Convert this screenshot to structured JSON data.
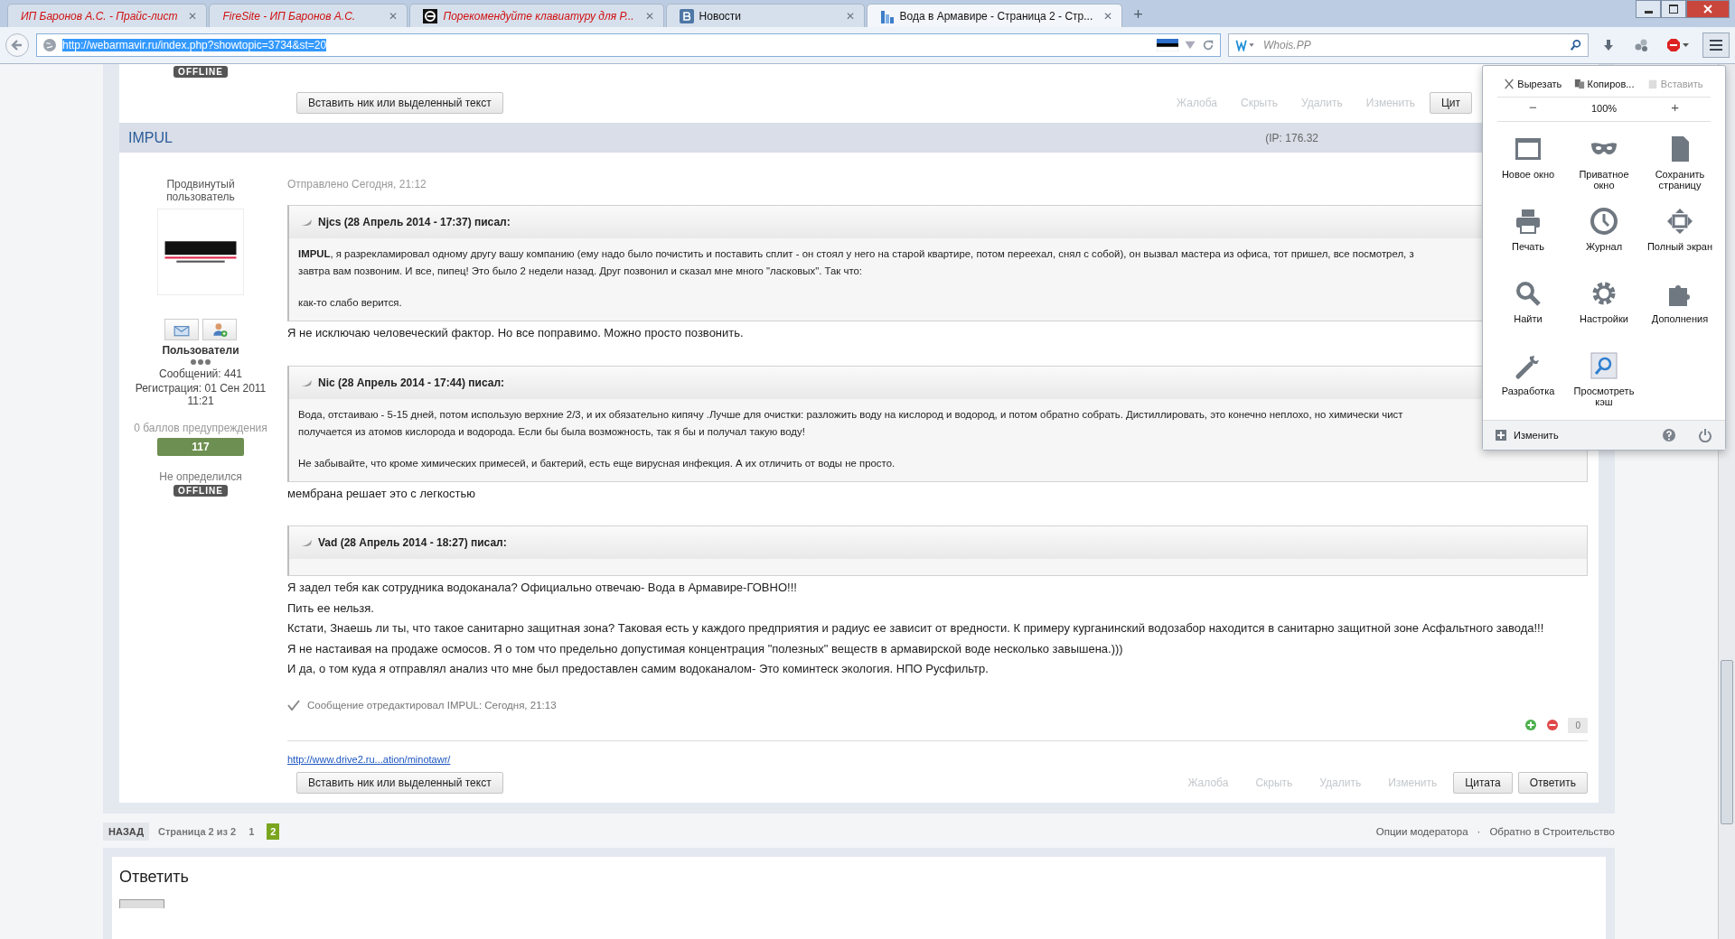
{
  "browser": {
    "tabs": [
      {
        "title": "ИП Баронов А.С. - Прайс-лист",
        "kind": "none",
        "unread": true,
        "selected": false
      },
      {
        "title": "FireSite - ИП Баронов А.С.",
        "kind": "none",
        "unread": true,
        "selected": false
      },
      {
        "title": "Порекомендуйте клавиатуру для Р...",
        "kind": "e-logo",
        "unread": true,
        "selected": false
      },
      {
        "title": "Новости",
        "kind": "vk",
        "unread": false,
        "selected": false
      },
      {
        "title": "Вода в Армавире - Страница 2 - Стр...",
        "kind": "site",
        "unread": false,
        "selected": true
      }
    ],
    "close": "✕",
    "new_tab": "+",
    "url": "http://webarmavir.ru/index.php?showtopic=3734&st=20",
    "search": {
      "placeholder": "Whois.PP"
    }
  },
  "menu": {
    "edit": [
      {
        "label": "Вырезать",
        "kind": "cut",
        "disabled": false
      },
      {
        "label": "Копиров...",
        "kind": "copy",
        "disabled": false
      },
      {
        "label": "Вставить",
        "kind": "paste",
        "disabled": true
      }
    ],
    "zoom": {
      "minus": "−",
      "value": "100%",
      "plus": "+"
    },
    "items": [
      {
        "label": "Новое окно",
        "kind": "window"
      },
      {
        "label": "Приватное окно",
        "kind": "mask"
      },
      {
        "label": "Сохранить страницу",
        "kind": "page"
      },
      {
        "label": "Печать",
        "kind": "printer"
      },
      {
        "label": "Журнал",
        "kind": "clock"
      },
      {
        "label": "Полный экран",
        "kind": "fullscreen"
      },
      {
        "label": "Найти",
        "kind": "search"
      },
      {
        "label": "Настройки",
        "kind": "gear"
      },
      {
        "label": "Дополнения",
        "kind": "puzzle"
      },
      {
        "label": "Разработка",
        "kind": "wrench"
      },
      {
        "label": "Просмотреть кэш",
        "kind": "cache"
      }
    ],
    "customize": "Изменить"
  },
  "previous_post": {
    "status": "OFFLINE",
    "insert_button": "Вставить ник или выделенный текст",
    "actions": [
      {
        "label": "Жалоба",
        "kind": "link"
      },
      {
        "label": "Скрыть",
        "kind": "link"
      },
      {
        "label": "Удалить",
        "kind": "link"
      },
      {
        "label": "Изменить",
        "kind": "link"
      },
      {
        "label": "Цит",
        "kind": "button"
      }
    ]
  },
  "post": {
    "author": "IMPUL",
    "ip": "(IP: 176.32",
    "user": {
      "title": "Продвинутый пользователь",
      "group": "Пользователи",
      "posts": "Сообщений: 441",
      "registered": "Регистрация: 01 Сен 2011 11:21",
      "warnings": "0 баллов предупреждения",
      "reputation": "117",
      "mood": "Не определился",
      "status": "OFFLINE"
    },
    "date": "Отправлено Сегодня, 21:12",
    "body": [
      {
        "kind": "quote",
        "header": "Njcs (28 Апрель 2014 - 17:37) писал:",
        "paragraphs": [
          "**IMPUL**, я разрекламировал одному другу вашу компанию (ему надо было почистить и поставить сплит - он стоял у него на старой квартире, потом переехал, снял с собой), он вызвал мастера из офиса, тот пришел, все посмотрел, з\nзавтра вам позвоним. И все, пипец! Это было 2 недели назад. Друг позвонил и сказал мне много \"ласковых\". Так что:",
          "как-то слабо верится."
        ]
      },
      {
        "kind": "text",
        "lines": [
          "Я не исключаю человеческий фактор. Но все поправимо. Можно просто позвонить."
        ]
      },
      {
        "kind": "quote",
        "header": "Nic (28 Апрель 2014 - 17:44) писал:",
        "paragraphs": [
          "Вода, отстаиваю - 5-15 дней, потом использую верхние 2/3, и их обязательно кипячу .Лучше для очистки: разложить воду на кислород и водород, и потом обратно собрать. Дистиллировать,  это конечно неплохо, но химически чист\nполучается из атомов кислорода и водорода. Если бы была возможность, так я бы и получал такую воду!",
          "Не забывайте, что кроме химических примесей, и бактерий, есть еще вирусная инфекция. А их отличить от воды не просто."
        ]
      },
      {
        "kind": "text",
        "lines": [
          "мембрана решает это с легкостью"
        ]
      },
      {
        "kind": "quote",
        "header": "Vad (28 Апрель 2014 - 18:27) писал:"
      },
      {
        "kind": "text",
        "lines": [
          "Я задел тебя как сотрудника водоканала? Официально отвечаю- Вода в Армавире-ГОВНО!!!",
          "Пить ее нельзя.",
          "Кстати, Знаешь ли ты, что такое санитарно защитная зона? Таковая есть у каждого предприятия и радиус ее зависит от вредности. К примеру курганинский водозабор находится в санитарно защитной зоне Асфальтного завода!!!",
          "Я не настаивая на продаже осмосов.  Я о том что предельно допустимая концентрация \"полезных\" веществ в армавирской воде несколько завышена.)))",
          "И да, о том куда я отправлял анализ что мне был предоставлен самим водоканалом- Это коминтеск экология. НПО Русфильтр."
        ]
      }
    ],
    "edit_note": "Сообщение отредактировал IMPUL: Сегодня, 21:13",
    "rating": "0",
    "signature_link": "http://www.drive2.ru...ation/minotawr/",
    "insert_button": "Вставить ник или выделенный текст",
    "actions": [
      {
        "label": "Жалоба",
        "kind": "link"
      },
      {
        "label": "Скрыть",
        "kind": "link"
      },
      {
        "label": "Удалить",
        "kind": "link"
      },
      {
        "label": "Изменить",
        "kind": "link"
      },
      {
        "label": "Цитата",
        "kind": "button"
      },
      {
        "label": "Ответить",
        "kind": "button"
      }
    ]
  },
  "pagination": {
    "back": "НАЗАД",
    "info": "Страница 2 из 2",
    "pages": [
      {
        "label": "1",
        "selected": false
      },
      {
        "label": "2",
        "selected": true
      }
    ],
    "links": [
      "Опции модератора",
      "Обратно в Строительство"
    ],
    "separator": "·"
  },
  "reply": {
    "title": "Ответить"
  }
}
